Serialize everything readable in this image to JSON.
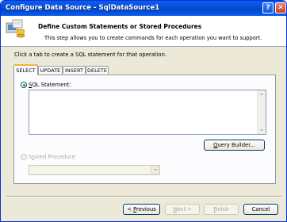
{
  "window": {
    "title": "Configure Data Source - SqlDataSource1",
    "help_glyph": "?",
    "close_glyph": "✕"
  },
  "header": {
    "title": "Define Custom Statements or Stored Procedures",
    "description": "This step allows you to create commands for each operation you want to support.",
    "icon": "wizard-data-icon"
  },
  "instruction": "Click a tab to create a SQL statement for that operation.",
  "tabs": [
    {
      "label": "SELECT",
      "selected": true
    },
    {
      "label": "UPDATE",
      "selected": false
    },
    {
      "label": "INSERT",
      "selected": false
    },
    {
      "label": "DELETE",
      "selected": false
    }
  ],
  "select_tab": {
    "sql_statement_option": {
      "label_prefix": "",
      "label_mnemonic": "S",
      "label_rest": "QL Statement:",
      "checked": true
    },
    "sql_statement_text": "",
    "query_builder_button": {
      "label_prefix": "",
      "label_mnemonic": "Q",
      "label_rest": "uery Builder..."
    },
    "stored_procedure_option": {
      "label_prefix": "S",
      "label_mnemonic": "t",
      "label_rest": "ored Procedure:",
      "checked": false,
      "enabled": false
    },
    "stored_procedure_value": ""
  },
  "footer": {
    "previous_button": {
      "label_prefix": "< ",
      "label_mnemonic": "P",
      "label_rest": "revious",
      "enabled": true
    },
    "next_button": {
      "label_prefix": "",
      "label_mnemonic": "N",
      "label_rest": "ext >",
      "enabled": false
    },
    "finish_button": {
      "label_prefix": "",
      "label_mnemonic": "F",
      "label_rest": "inish",
      "enabled": false
    },
    "cancel_button": {
      "label": "Cancel",
      "enabled": true
    }
  },
  "colors": {
    "titlebar": "#0650d8",
    "dialog_background": "#ece9d8",
    "selected_tab_accent": "#f7b33d"
  }
}
